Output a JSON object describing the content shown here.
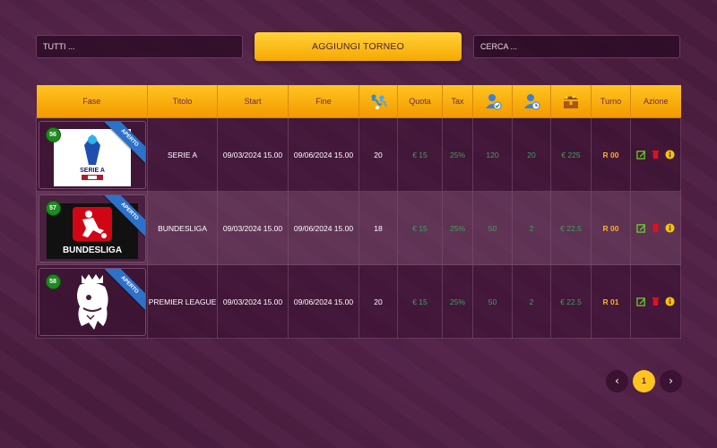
{
  "filters": {
    "select_label": "TUTTI ...",
    "add_button": "AGGIUNGI TORNEO",
    "search_placeholder": "CERCA ..."
  },
  "table": {
    "headers": {
      "fase": "Fase",
      "titolo": "Titolo",
      "start": "Start",
      "fine": "Fine",
      "players_icon": "players-icon",
      "quota": "Quota",
      "tax": "Tax",
      "user_check_icon": "user-check-icon",
      "user_clock_icon": "user-clock-icon",
      "treasure_icon": "treasure-chest-icon",
      "turno": "Turno",
      "azione": "Azione"
    },
    "rows": [
      {
        "id": "56",
        "status": "APERTO",
        "logo": "serie-a-logo",
        "logo_text": "SERIE A",
        "title": "SERIE A",
        "start": "09/03/2024 15.00",
        "end": "09/06/2024 15.00",
        "players": "20",
        "quota": "€ 15",
        "tax": "25%",
        "subscribed": "120",
        "waiting": "20",
        "prize": "€ 225",
        "round": "R 00"
      },
      {
        "id": "57",
        "status": "APERTO",
        "logo": "bundesliga-logo",
        "logo_text": "BUNDESLIGA",
        "title": "BUNDESLIGA",
        "start": "09/03/2024 15.00",
        "end": "09/06/2024 15.00",
        "players": "18",
        "quota": "€ 15",
        "tax": "25%",
        "subscribed": "50",
        "waiting": "2",
        "prize": "€ 22.5",
        "round": "R 00"
      },
      {
        "id": "58",
        "status": "APERTO",
        "logo": "premier-league-logo",
        "logo_text": "",
        "title": "PREMIER LEAGUE",
        "start": "09/03/2024 15.00",
        "end": "09/06/2024 15.00",
        "players": "20",
        "quota": "€ 15",
        "tax": "25%",
        "subscribed": "50",
        "waiting": "2",
        "prize": "€ 22.5",
        "round": "R 01"
      }
    ],
    "action_icons": [
      "edit-icon",
      "delete-icon",
      "info-icon"
    ]
  },
  "pagination": {
    "prev": "‹",
    "current": "1",
    "next": "›"
  },
  "colors": {
    "background": "#4a1d3f",
    "header": "#ffc420",
    "accent_green": "#3fa05a",
    "accent_orange": "#ffb020",
    "ribbon": "#2d72c9"
  }
}
